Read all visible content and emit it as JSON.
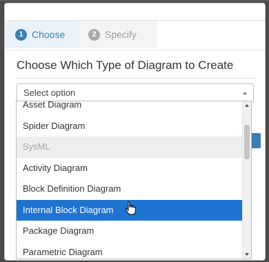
{
  "wizard": {
    "steps": [
      {
        "number": "1",
        "label": "Choose"
      },
      {
        "number": "2",
        "label": "Specify"
      }
    ]
  },
  "dialog": {
    "title": "Choose Which Type of Diagram to Create"
  },
  "diagram_type_select": {
    "placeholder": "Select option",
    "options": [
      {
        "label": "Asset Diagram"
      },
      {
        "label": "Spider Diagram"
      },
      {
        "label": "SysML",
        "group_header": true
      },
      {
        "label": "Activity Diagram"
      },
      {
        "label": "Block Definition Diagram"
      },
      {
        "label": "Internal Block Diagram",
        "highlighted": true
      },
      {
        "label": "Package Diagram"
      },
      {
        "label": "Parametric Diagram"
      }
    ]
  },
  "colors": {
    "accent": "#3a7fb4",
    "highlight": "#1f74d2"
  }
}
